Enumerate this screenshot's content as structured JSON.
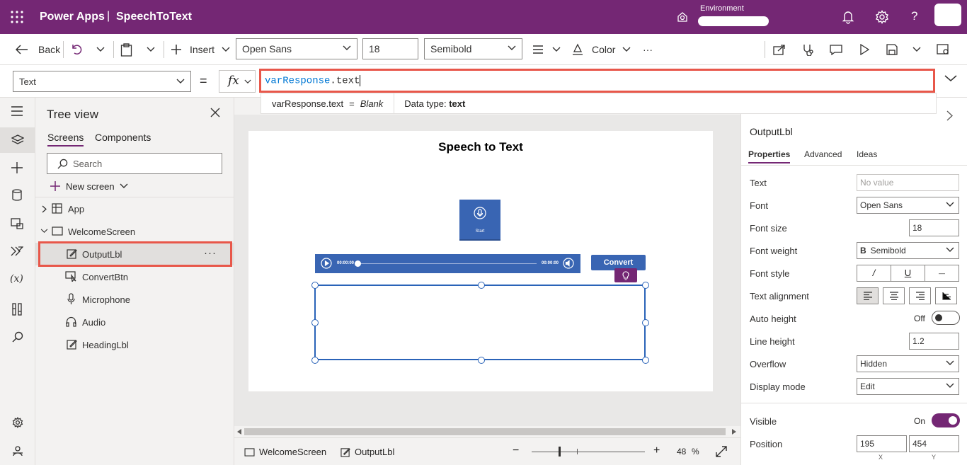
{
  "app": {
    "brand": "Power Apps",
    "separator": "|",
    "name": "SpeechToText",
    "environment_label": "Environment"
  },
  "toolbar": {
    "back": "Back",
    "insert": "Insert",
    "font": "Open Sans",
    "font_size": "18",
    "font_weight": "Semibold",
    "color": "Color",
    "more": "···"
  },
  "formula": {
    "property": "Text",
    "equals": "=",
    "fx": "fx",
    "var": "varResponse",
    "rest": ".text",
    "hint_expr": "varResponse.text",
    "hint_eq": "=",
    "hint_val": "Blank",
    "hint_type_label": "Data type:",
    "hint_type": "text"
  },
  "tree": {
    "title": "Tree view",
    "tabs": [
      "Screens",
      "Components"
    ],
    "search_placeholder": "Search",
    "new_screen": "New screen",
    "items": [
      {
        "label": "App"
      },
      {
        "label": "WelcomeScreen"
      },
      {
        "label": "OutputLbl"
      },
      {
        "label": "ConvertBtn"
      },
      {
        "label": "Microphone"
      },
      {
        "label": "Audio"
      },
      {
        "label": "HeadingLbl"
      }
    ],
    "more": "···"
  },
  "canvas": {
    "heading": "Speech to Text",
    "mic_label": "Start",
    "audio_start": "00:00:00",
    "audio_end": "00:00:00",
    "convert": "Convert"
  },
  "bottom": {
    "screen": "WelcomeScreen",
    "control": "OutputLbl",
    "zoom": "48",
    "zoom_unit": "%",
    "zoom_minus": "−",
    "zoom_plus": "+"
  },
  "props": {
    "control_name": "OutputLbl",
    "tabs": [
      "Properties",
      "Advanced",
      "Ideas"
    ],
    "rows": [
      {
        "label": "Text",
        "value": "No value"
      },
      {
        "label": "Font",
        "value": "Open Sans"
      },
      {
        "label": "Font size",
        "value": "18"
      },
      {
        "label": "Font weight",
        "value": "Semibold",
        "prefix": "B"
      },
      {
        "label": "Font style",
        "value": ""
      },
      {
        "label": "Text alignment",
        "value": ""
      },
      {
        "label": "Auto height",
        "value": "Off"
      },
      {
        "label": "Line height",
        "value": "1.2"
      },
      {
        "label": "Overflow",
        "value": "Hidden"
      },
      {
        "label": "Display mode",
        "value": "Edit"
      },
      {
        "label": "Visible",
        "value": "On"
      },
      {
        "label": "Position",
        "x": "195",
        "y": "454",
        "x_label": "X",
        "y_label": "Y"
      }
    ],
    "font_style_buttons": [
      "/",
      "U",
      "—"
    ]
  },
  "colors": {
    "brand": "#742774",
    "control_blue": "#3965b3",
    "highlight": "#e8574a"
  }
}
